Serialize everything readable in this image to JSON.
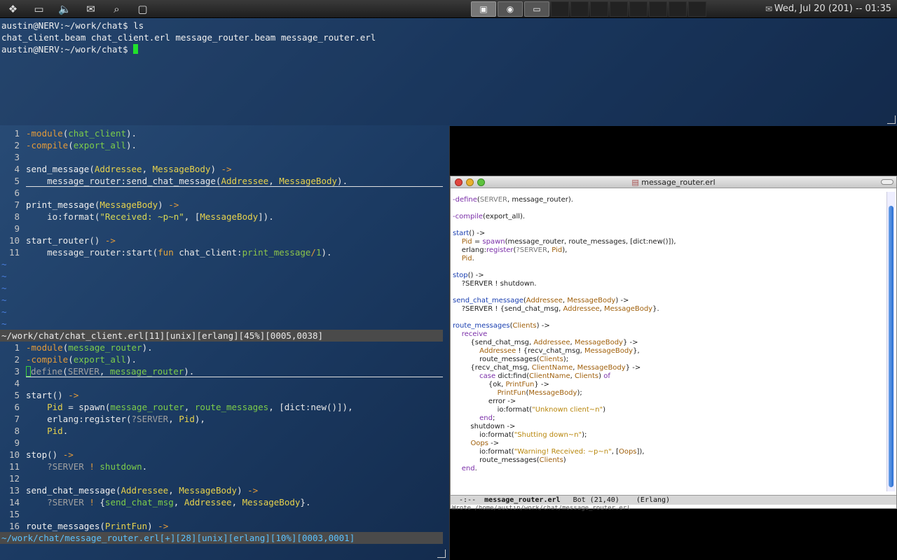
{
  "panel": {
    "clock": "Wed, Jul 20 (201) -- 01:35",
    "launchers": [
      "distro-menu",
      "files",
      "volume",
      "mail",
      "search",
      "window-list"
    ]
  },
  "terminal": {
    "lines": [
      "austin@NERV:~/work/chat$ ls",
      "chat_client.beam  chat_client.erl  message_router.beam  message_router.erl",
      "austin@NERV:~/work/chat$ "
    ]
  },
  "vim_top": {
    "status": "~/work/chat/chat_client.erl[11][unix][erlang][45%][0005,0038]",
    "tilde_count": 6
  },
  "vim_bottom": {
    "status": "~/work/chat/message_router.erl[+][28][unix][erlang][10%][0003,0001]"
  },
  "emacs": {
    "title": "message_router.erl",
    "mode_line_left": " -:--  ",
    "mode_line_buffer": "message_router.erl",
    "mode_line_pos": "   Bot (21,40)",
    "mode_line_mode": "    (Erlang)",
    "echo": "Wrote /home/austin/work/chat/message_router.erl"
  }
}
